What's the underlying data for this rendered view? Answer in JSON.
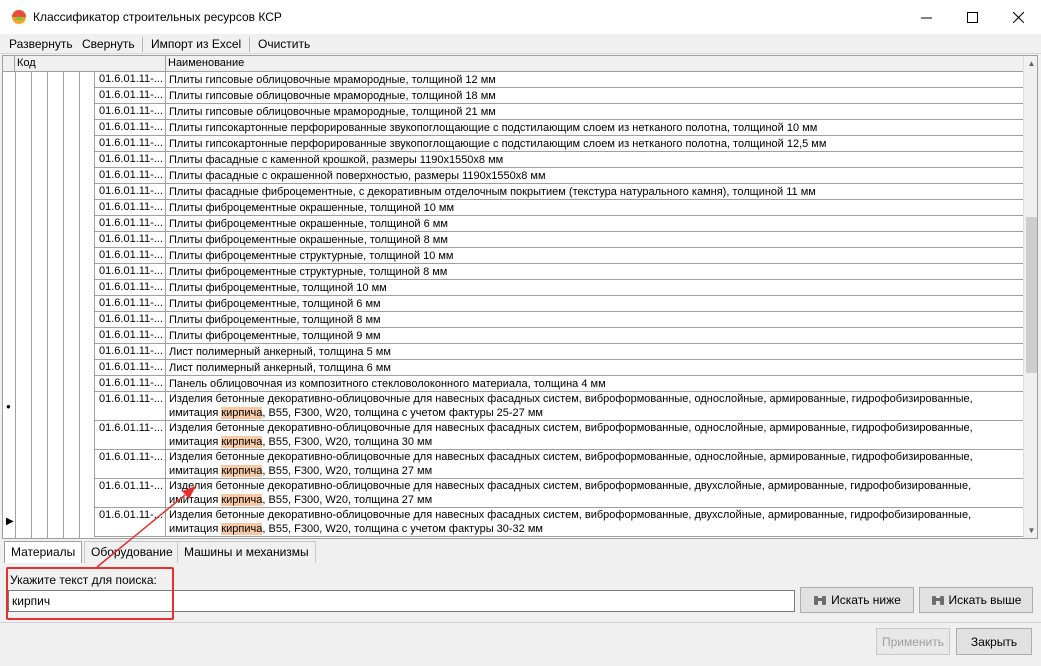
{
  "window": {
    "title": "Классификатор строительных ресурсов КСР",
    "controls": [
      "minimize",
      "maximize",
      "close"
    ]
  },
  "toolbar": {
    "items": [
      "Развернуть",
      "Свернуть",
      "Импорт из Excel",
      "Очистить"
    ]
  },
  "grid": {
    "columns": [
      "Код",
      "Наименование"
    ],
    "rows": [
      {
        "code": "01.6.01.11-...",
        "name": "Плиты гипсовые облицовочные мрамородные, толщиной 12 мм"
      },
      {
        "code": "01.6.01.11-...",
        "name": "Плиты гипсовые облицовочные мрамородные, толщиной 18 мм"
      },
      {
        "code": "01.6.01.11-...",
        "name": "Плиты гипсовые облицовочные мрамородные, толщиной 21 мм"
      },
      {
        "code": "01.6.01.11-...",
        "name": "Плиты гипсокартонные перфорированные звукопоглощающие с подстилающим слоем из нетканого полотна, толщиной 10 мм"
      },
      {
        "code": "01.6.01.11-...",
        "name": "Плиты гипсокартонные перфорированные звукопоглощающие с подстилающим слоем из нетканого полотна, толщиной 12,5 мм"
      },
      {
        "code": "01.6.01.11-...",
        "name": "Плиты фасадные с каменной крошкой, размеры 1190х1550х8 мм"
      },
      {
        "code": "01.6.01.11-...",
        "name": "Плиты фасадные с окрашенной поверхностью, размеры 1190х1550х8 мм"
      },
      {
        "code": "01.6.01.11-...",
        "name": "Плиты фасадные фиброцементные, с декоративным отделочным покрытием (текстура натурального камня), толщиной 11 мм"
      },
      {
        "code": "01.6.01.11-...",
        "name": "Плиты фиброцементные окрашенные, толщиной 10 мм"
      },
      {
        "code": "01.6.01.11-...",
        "name": "Плиты фиброцементные окрашенные, толщиной 6 мм"
      },
      {
        "code": "01.6.01.11-...",
        "name": "Плиты фиброцементные окрашенные, толщиной 8 мм"
      },
      {
        "code": "01.6.01.11-...",
        "name": "Плиты фиброцементные структурные, толщиной 10 мм"
      },
      {
        "code": "01.6.01.11-...",
        "name": "Плиты фиброцементные структурные, толщиной 8 мм"
      },
      {
        "code": "01.6.01.11-...",
        "name": "Плиты фиброцементные, толщиной 10 мм"
      },
      {
        "code": "01.6.01.11-...",
        "name": "Плиты фиброцементные, толщиной 6 мм"
      },
      {
        "code": "01.6.01.11-...",
        "name": "Плиты фиброцементные, толщиной 8 мм"
      },
      {
        "code": "01.6.01.11-...",
        "name": "Плиты фиброцементные, толщиной 9 мм"
      },
      {
        "code": "01.6.01.11-...",
        "name": "Лист полимерный анкерный, толщина 5 мм"
      },
      {
        "code": "01.6.01.11-...",
        "name": "Лист полимерный анкерный, толщина 6 мм"
      },
      {
        "code": "01.6.01.11-...",
        "name": "Панель облицовочная из композитного стекловолоконного материала, толщина 4 мм"
      },
      {
        "code": "01.6.01.11-...",
        "line1": "Изделия бетонные декоративно-облицовочные для навесных фасадных систем, виброформованные, однослойные, армированные, гидрофобизированные,",
        "pre": "имитация ",
        "hl": "кирпича",
        "post": ", B55, F300, W20, толщина с учетом фактуры 25-27 мм"
      },
      {
        "code": "01.6.01.11-...",
        "line1": "Изделия бетонные декоративно-облицовочные для навесных фасадных систем, виброформованные, однослойные, армированные, гидрофобизированные,",
        "pre": "имитация ",
        "hl": "кирпича",
        "post": ", B55, F300, W20, толщина 30 мм"
      },
      {
        "code": "01.6.01.11-...",
        "line1": "Изделия бетонные декоративно-облицовочные для навесных фасадных систем, виброформованные, однослойные, армированные, гидрофобизированные,",
        "pre": "имитация ",
        "hl": "кирпича",
        "post": ", B55, F300, W20, толщина 27 мм"
      },
      {
        "code": "01.6.01.11-...",
        "line1": "Изделия бетонные декоративно-облицовочные для навесных фасадных систем, виброформованные, двухслойные, армированные, гидрофобизированные,",
        "pre": "имитация ",
        "hl": "кирпича",
        "post": ", B55, F300, W20, толщина 27 мм"
      },
      {
        "code": "01.6.01.11-...",
        "line1": "Изделия бетонные декоративно-облицовочные для навесных фасадных систем, виброформованные, двухслойные, армированные, гидрофобизированные,",
        "pre": "имитация ",
        "hl": "кирпича",
        "post": ", B55, F300, W20, толщина с учетом фактуры 30-32 мм"
      }
    ]
  },
  "tabs": [
    "Материалы",
    "Оборудование",
    "Машины и механизмы"
  ],
  "search": {
    "label": "Укажите текст для поиска:",
    "value": "кирпич",
    "find_next": "Искать ниже",
    "find_prev": "Искать выше"
  },
  "footer": {
    "apply": "Применить",
    "close": "Закрыть"
  },
  "colors": {
    "highlight": "#f7c9a4",
    "annotation": "#e53030"
  }
}
